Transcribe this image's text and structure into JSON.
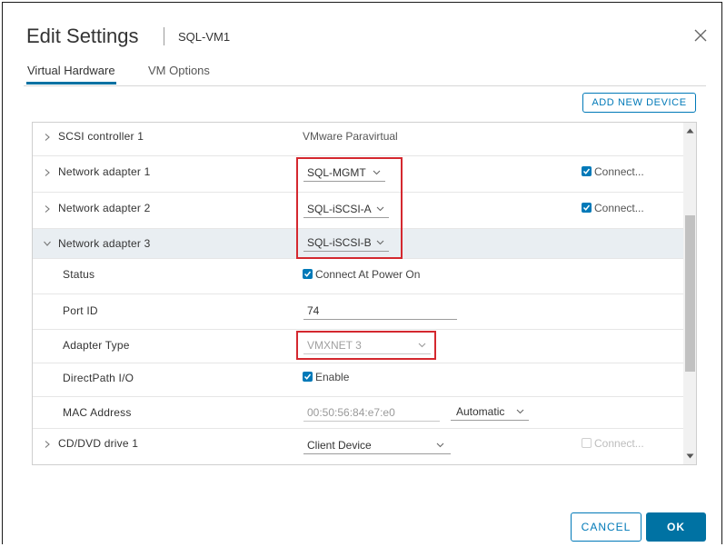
{
  "dialog": {
    "title": "Edit Settings",
    "vm_name": "SQL-VM1",
    "close_icon": "close-icon"
  },
  "tabs": [
    {
      "label": "Virtual Hardware",
      "active": true
    },
    {
      "label": "VM Options",
      "active": false
    }
  ],
  "toolbar": {
    "add_new_device_label": "ADD NEW DEVICE"
  },
  "hardware": {
    "scsi": {
      "label": "SCSI controller 1",
      "value": "VMware Paravirtual"
    },
    "net1": {
      "label": "Network adapter 1",
      "network": "SQL-MGMT",
      "connect_label": "Connect...",
      "connected": true
    },
    "net2": {
      "label": "Network adapter 2",
      "network": "SQL-iSCSI-A",
      "connect_label": "Connect...",
      "connected": true
    },
    "net3": {
      "label": "Network adapter 3",
      "network": "SQL-iSCSI-B",
      "status": {
        "label": "Status",
        "checkbox_label": "Connect At Power On",
        "checked": true
      },
      "port_id": {
        "label": "Port ID",
        "value": "74"
      },
      "adapter_type": {
        "label": "Adapter Type",
        "value": "VMXNET 3"
      },
      "directpath": {
        "label": "DirectPath I/O",
        "checkbox_label": "Enable",
        "checked": true
      },
      "mac": {
        "label": "MAC Address",
        "value": "00:50:56:84:e7:e0",
        "mode": "Automatic"
      }
    },
    "cddvd": {
      "label": "CD/DVD drive 1",
      "value": "Client Device",
      "connect_label": "Connect...",
      "connected": false
    }
  },
  "footer": {
    "cancel_label": "CANCEL",
    "ok_label": "OK"
  },
  "colors": {
    "accent": "#0079b8",
    "primary_button": "#0072a3",
    "highlight_box": "#d4282f",
    "expanded_row": "#e9eef2"
  }
}
